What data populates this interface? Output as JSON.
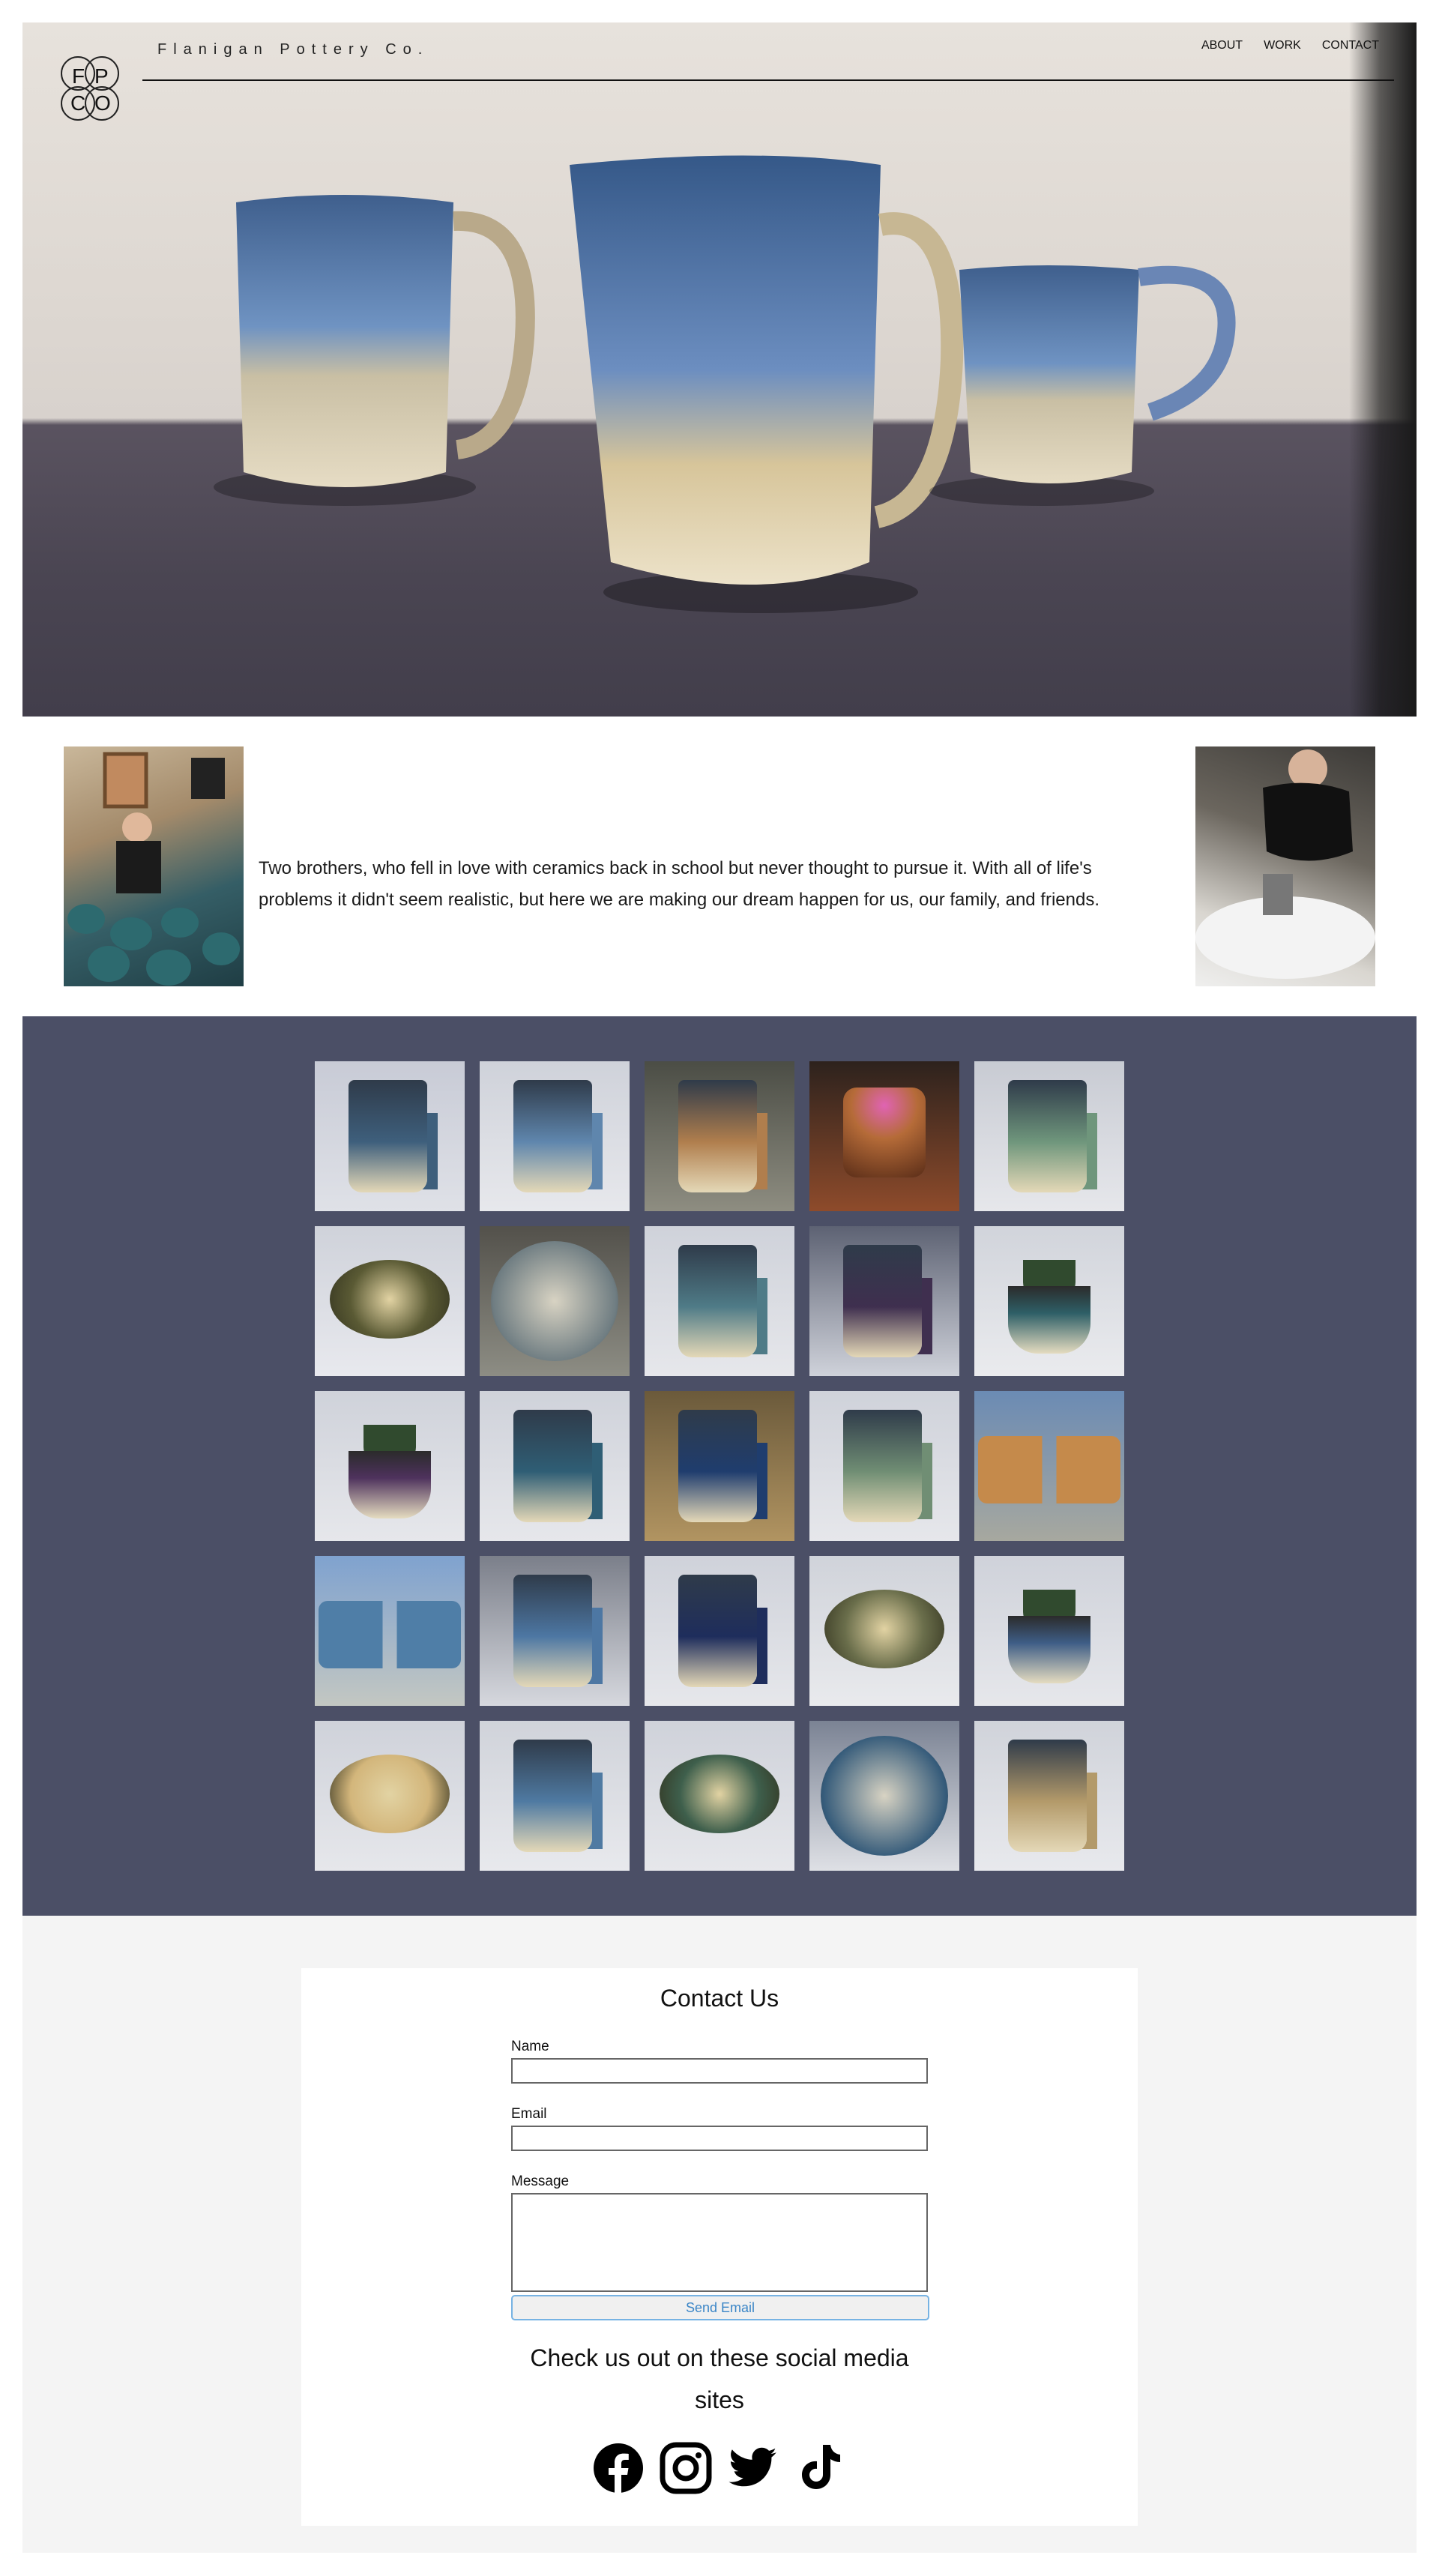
{
  "header": {
    "brand": "Flanigan Pottery Co.",
    "logo_letters": [
      "F",
      "P",
      "C",
      "O"
    ],
    "nav": [
      "ABOUT",
      "WORK",
      "CONTACT"
    ]
  },
  "about": {
    "text": "Two brothers, who fell in love with ceramics back in school but never thought to pursue it. With all of life's problems it didn't seem realistic, but here we are making our dream happen for us, our family, and friends."
  },
  "contact": {
    "title": "Contact Us",
    "name_label": "Name",
    "email_label": "Email",
    "message_label": "Message",
    "send_label": "Send Email",
    "social_title_line1": "Check us out on these social media",
    "social_title_line2": "sites",
    "social": [
      "facebook-icon",
      "instagram-icon",
      "twitter-icon",
      "tiktok-icon"
    ]
  },
  "colors": {
    "gallery_bg": "#4b4f66",
    "contact_bg": "#f4f4f4",
    "send_border": "#77b3e3"
  }
}
